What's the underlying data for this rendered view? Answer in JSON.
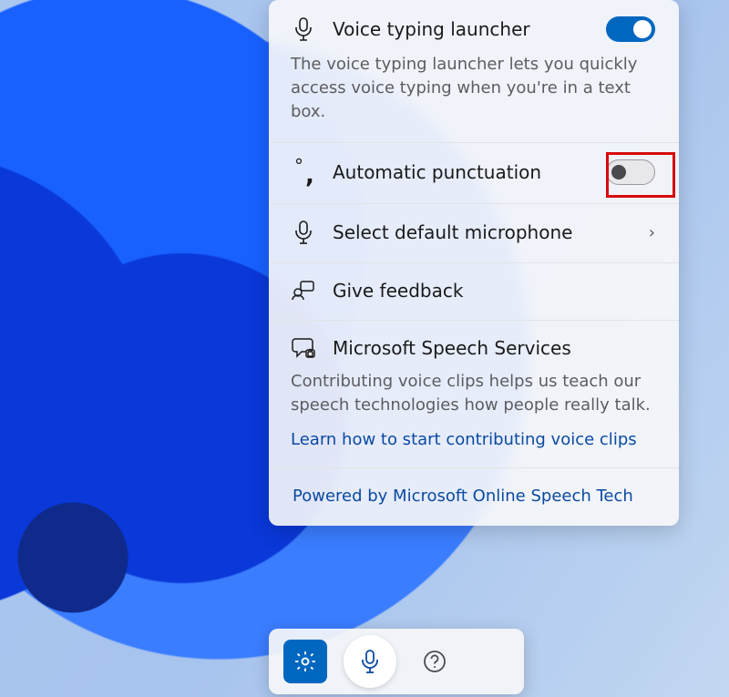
{
  "accent": "#0067c0",
  "launcher": {
    "title": "Voice typing launcher",
    "description": "The voice typing launcher lets you quickly access voice typing when you're in a text box.",
    "enabled": true
  },
  "auto_punct": {
    "title": "Automatic punctuation",
    "enabled": false,
    "highlighted": true
  },
  "select_mic": {
    "title": "Select default microphone"
  },
  "feedback": {
    "title": "Give feedback"
  },
  "speech_services": {
    "title": "Microsoft Speech Services",
    "description": "Contributing voice clips helps us teach our speech technologies how people really talk.",
    "link_text": "Learn how to start contributing voice clips"
  },
  "footer": {
    "powered_by": "Powered by Microsoft Online Speech Tech"
  },
  "toolbar": {
    "settings_label": "Settings",
    "mic_label": "Microphone",
    "help_label": "Help"
  }
}
